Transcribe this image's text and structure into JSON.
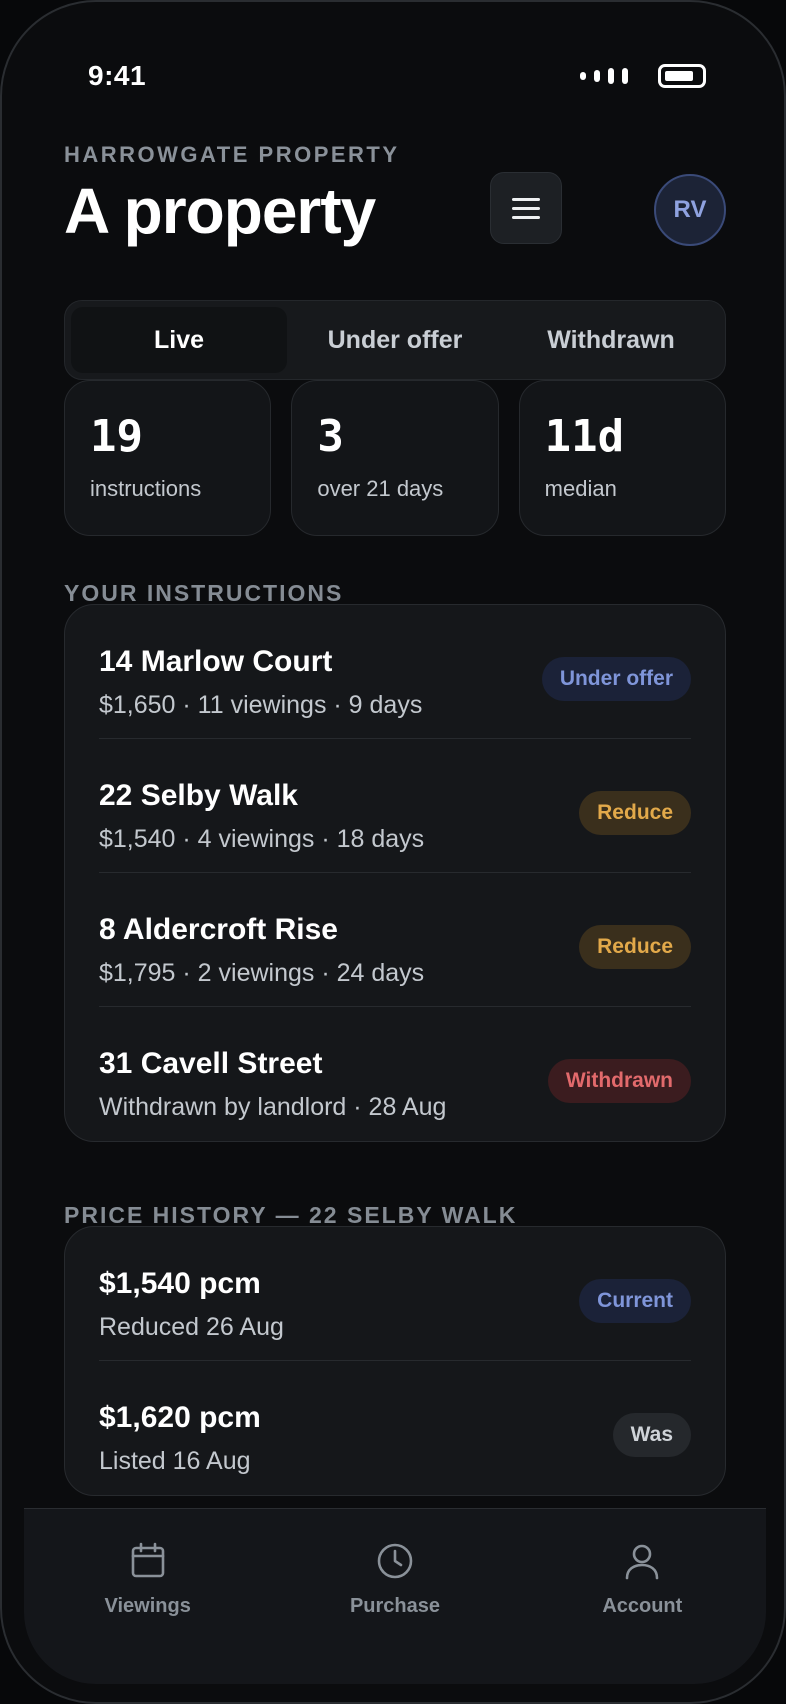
{
  "status_bar": {
    "time": "9:41"
  },
  "header": {
    "kicker": "HARROWGATE PROPERTY",
    "title": "A property",
    "menu_icon": "hamburger-menu-icon",
    "avatar_initials": "RV"
  },
  "tabs": [
    {
      "label": "Live",
      "active": true
    },
    {
      "label": "Under offer",
      "active": false
    },
    {
      "label": "Withdrawn",
      "active": false
    }
  ],
  "stats": [
    {
      "value": "19",
      "label": "instructions"
    },
    {
      "value": "3",
      "label": "over 21 days"
    },
    {
      "value": "11d",
      "label": "median"
    }
  ],
  "instructions": {
    "section_label": "YOUR INSTRUCTIONS",
    "items": [
      {
        "title": "14 Marlow Court",
        "subtitle": "$1,650 · 11 viewings · 9 days",
        "badge": "Under offer",
        "badge_color": "#7f95d9"
      },
      {
        "title": "22 Selby Walk",
        "subtitle": "$1,540 · 4 viewings · 18 days",
        "badge": "Reduce",
        "badge_color": "#e2a94a"
      },
      {
        "title": "8 Aldercroft Rise",
        "subtitle": "$1,795 · 2 viewings · 24 days",
        "badge": "Reduce",
        "badge_color": "#e2a94a"
      },
      {
        "title": "31 Cavell Street",
        "subtitle": "Withdrawn by landlord · 28 Aug",
        "badge": "Withdrawn",
        "badge_color": "#e26a6c"
      }
    ]
  },
  "price_history": {
    "section_label": "PRICE HISTORY — 22 SELBY WALK",
    "items": [
      {
        "price": "$1,540 pcm",
        "note": "Reduced 26 Aug",
        "badge": "Current"
      },
      {
        "price": "$1,620 pcm",
        "note": "Listed 16 Aug",
        "badge": "Was"
      }
    ]
  },
  "bottom_nav": [
    {
      "label": "Viewings",
      "icon": "calendar-icon"
    },
    {
      "label": "Purchase",
      "icon": "clock-icon"
    },
    {
      "label": "Account",
      "icon": "person-icon"
    }
  ]
}
